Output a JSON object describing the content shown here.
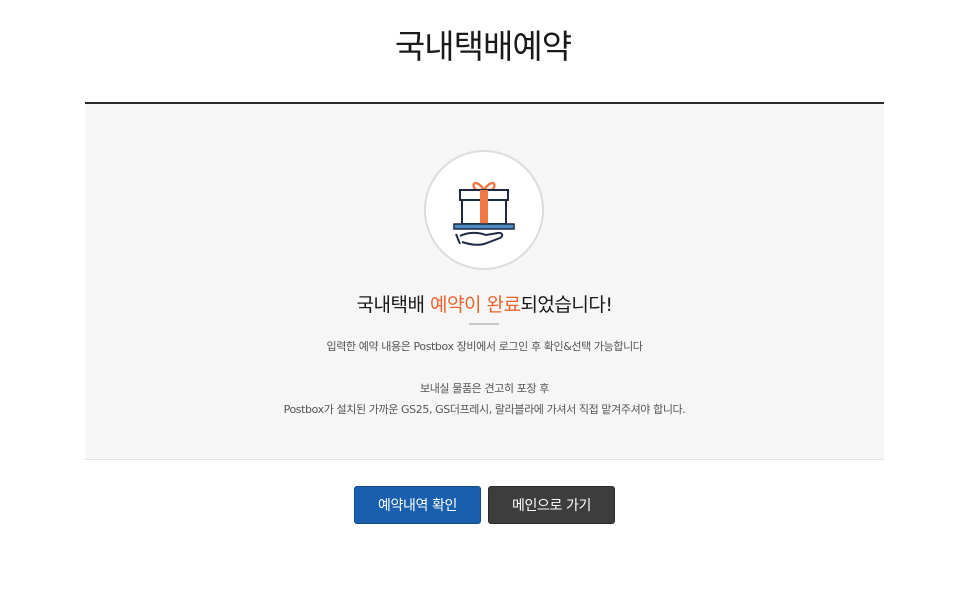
{
  "page": {
    "title": "국내택배예약"
  },
  "complete": {
    "icon": "gift-box-on-hand-icon",
    "headline_prefix": "국내택배 ",
    "headline_highlight": "예약이 완료",
    "headline_suffix": "되었습니다!",
    "description_line1": "입력한 예약 내용은 Postbox 장비에서 로그인 후 확인&선택 가능합니다",
    "description_line2": "보내실 물품은 견고히 포장 후",
    "description_line3": "Postbox가 설치된 가까운 GS25, GS더프레시, 랄라블라에 가셔서 직접 맡겨주셔야 합니다."
  },
  "actions": {
    "check_reservation_label": "예약내역 확인",
    "go_main_label": "메인으로 가기"
  },
  "colors": {
    "highlight": "#e8652e",
    "primary_button": "#1a5fae",
    "secondary_button": "#3d3d3d",
    "panel_background": "#f6f6f6"
  }
}
